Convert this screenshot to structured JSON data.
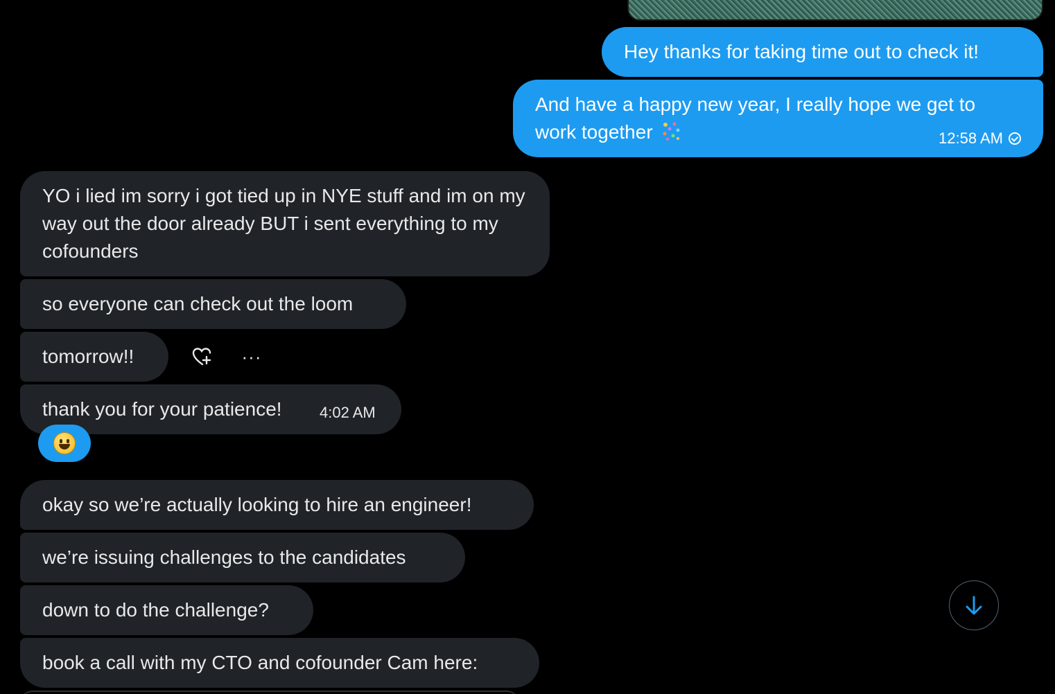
{
  "conversation": {
    "messages": [
      {
        "id": "m1",
        "direction": "outgoing",
        "text": "Hey thanks for taking time out to check it!"
      },
      {
        "id": "m2",
        "direction": "outgoing",
        "text": "And have a happy new year, I really hope we get to work together",
        "emoji": "party-icon",
        "time": "12:58 AM",
        "status": "seen"
      },
      {
        "id": "m3",
        "direction": "incoming",
        "text": "YO i lied im sorry i got tied up in NYE stuff and im on my way out the door already BUT i sent everything to my cofounders"
      },
      {
        "id": "m4",
        "direction": "incoming",
        "text": "so everyone can check out the loom"
      },
      {
        "id": "m5",
        "direction": "incoming",
        "text": "tomorrow!!"
      },
      {
        "id": "m6",
        "direction": "incoming",
        "text": "thank you for your patience!",
        "time": "4:02 AM",
        "reaction": "grinning-face-emoji"
      },
      {
        "id": "m7",
        "direction": "incoming",
        "text": "okay so we’re actually looking to hire an engineer!"
      },
      {
        "id": "m8",
        "direction": "incoming",
        "text": "we’re issuing challenges to the candidates"
      },
      {
        "id": "m9",
        "direction": "incoming",
        "text": "down to do the challenge?"
      },
      {
        "id": "m10",
        "direction": "incoming",
        "text": "book a call with my CTO and cofounder Cam here:"
      }
    ],
    "hover_actions": {
      "react_icon": "heart-plus-icon",
      "more_label": "···"
    },
    "scroll_button_icon": "arrow-down-icon"
  },
  "colors": {
    "background": "#000000",
    "outgoing_bubble": "#1d9bf0",
    "incoming_bubble": "#202327",
    "text": "#e7e9ea",
    "accent": "#1d9bf0"
  }
}
